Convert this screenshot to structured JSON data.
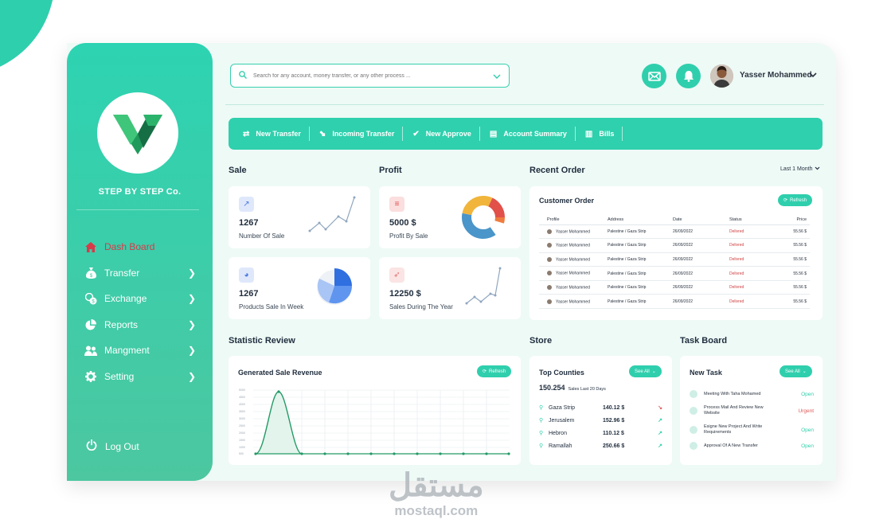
{
  "brand": {
    "company": "STEP BY STEP Co."
  },
  "nav": {
    "items": [
      {
        "label": "Dash Board",
        "icon": "home-icon",
        "active": true
      },
      {
        "label": "Transfer",
        "icon": "money-bag-icon"
      },
      {
        "label": "Exchange",
        "icon": "exchange-icon"
      },
      {
        "label": "Reports",
        "icon": "pie-icon"
      },
      {
        "label": "Mangment",
        "icon": "users-icon"
      },
      {
        "label": "Setting",
        "icon": "gear-icon"
      }
    ],
    "logout": "Log Out"
  },
  "search": {
    "placeholder": "Search for any account, money transfer, or any other process ..."
  },
  "user": {
    "name": "Yasser Mohammed"
  },
  "actions": [
    "New Transfer",
    "Incoming Transfer",
    "New Approve",
    "Account Summary",
    "Bills"
  ],
  "sale": {
    "title": "Sale",
    "kpi1": {
      "value": "1267",
      "label": "Number Of Sale"
    },
    "kpi2": {
      "value": "1267",
      "label": "Products Sale In Week"
    }
  },
  "profit": {
    "title": "Profit",
    "kpi1": {
      "value": "5000 $",
      "label": "Profit By Sale"
    },
    "kpi2": {
      "value": "12250 $",
      "label": "Sales During The Year"
    }
  },
  "recent_order": {
    "title": "Recent Order",
    "filter": "Last 1 Month",
    "card_title": "Customer Order",
    "refresh": "Refresh",
    "headers": [
      "Profile",
      "Address",
      "Date",
      "Status",
      "Price"
    ],
    "rows": [
      [
        "Yasser Mohammed",
        "Palestine / Gaza Strip",
        "26/09/2022",
        "Delivred",
        "55.56 $"
      ],
      [
        "Yasser Mohammed",
        "Palestine / Gaza Strip",
        "26/09/2022",
        "Delivred",
        "55.56 $"
      ],
      [
        "Yasser Mohammed",
        "Palestine / Gaza Strip",
        "26/09/2022",
        "Delivred",
        "55.56 $"
      ],
      [
        "Yasser Mohammed",
        "Palestine / Gaza Strip",
        "26/09/2022",
        "Delivred",
        "55.56 $"
      ],
      [
        "Yasser Mohammed",
        "Palestine / Gaza Strip",
        "26/09/2022",
        "Delivred",
        "55.56 $"
      ],
      [
        "Yasser Mohammed",
        "Palestine / Gaza Strip",
        "26/09/2022",
        "Delivred",
        "55.56 $"
      ]
    ]
  },
  "statistic": {
    "title": "Statistic Review",
    "card_title": "Generated Sale Revenue",
    "refresh": "Refresh"
  },
  "store": {
    "title": "Store",
    "card_title": "Top Counties",
    "see_all": "See All",
    "total": "150.254",
    "total_label": "Sales Last 20 Days",
    "rows": [
      {
        "name": "Gaza Strip",
        "value": "140.12 $",
        "trend": "down"
      },
      {
        "name": "Jerusalem",
        "value": "152.96 $",
        "trend": "up"
      },
      {
        "name": "Hebron",
        "value": "110.12 $",
        "trend": "up"
      },
      {
        "name": "Ramallah",
        "value": "250.66 $",
        "trend": "up"
      }
    ]
  },
  "tasks": {
    "title": "Task Board",
    "card_title": "New Task",
    "see_all": "See All",
    "rows": [
      {
        "text": "Meeting With Taha Mohamed",
        "status": "Open"
      },
      {
        "text": "Process Mail And Review New Website",
        "status": "Urgent"
      },
      {
        "text": "Esigne New Project And Write Requirements",
        "status": "Open"
      },
      {
        "text": "Approval Of A New Transfer",
        "status": "Open"
      }
    ]
  },
  "watermark": {
    "arabic": "مستقل",
    "latin": "mostaql.com"
  },
  "colors": {
    "accent": "#2fcfad",
    "active": "#d83a4a",
    "urgent": "#e05a5a",
    "open": "#2fcfad"
  }
}
